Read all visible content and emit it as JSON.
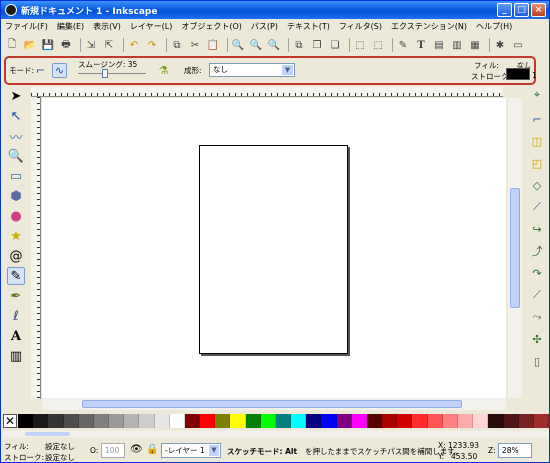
{
  "window": {
    "title": "新規ドキュメント 1 - Inkscape",
    "minimize": "_",
    "maximize": "□",
    "close": "×"
  },
  "menu": [
    "ファイル(F)",
    "編集(E)",
    "表示(V)",
    "レイヤー(L)",
    "オブジェクト(O)",
    "パス(P)",
    "テキスト(T)",
    "フィルタ(S)",
    "エクステンション(N)",
    "ヘルプ(H)"
  ],
  "tool_controls": {
    "mode_label": "モード:",
    "smoothing_label": "スムージング: 35",
    "smoothing_value": 35,
    "shape_label": "成形:",
    "shape_value": "なし",
    "fill_label": "フィル:",
    "fill_value": "なし",
    "stroke_label": "ストローク:",
    "stroke_width": "1"
  },
  "status": {
    "fill_label": "フィル:",
    "fill_value": "設定なし",
    "stroke_label": "ストローク:",
    "stroke_value": "設定なし",
    "opacity_label": "O:",
    "opacity_value": "100",
    "layer_value": "-レイヤー 1",
    "message_bold": "スケッチモード: Alt",
    "message": " を押したままでスケッチパス間を補間します。",
    "x_label": "X:",
    "x_value": "1233.93",
    "y_label": "Y:",
    "y_value": "453.50",
    "zoom_label": "Z:",
    "zoom_value": "28%"
  },
  "palette": [
    "#000000",
    "#1a1a1a",
    "#333333",
    "#4d4d4d",
    "#666666",
    "#808080",
    "#999999",
    "#b3b3b3",
    "#cccccc",
    "#e6e6e6",
    "#ffffff",
    "#800000",
    "#ff0000",
    "#808000",
    "#ffff00",
    "#008000",
    "#00ff00",
    "#008080",
    "#00ffff",
    "#000080",
    "#0000ff",
    "#800080",
    "#ff00ff",
    "#550000",
    "#aa0000",
    "#d40000",
    "#ff2a2a",
    "#ff5555",
    "#ff8080",
    "#ffaaaa",
    "#ffd5d5",
    "#280b0b",
    "#501616",
    "#782121",
    "#a02c2c"
  ],
  "colors": {
    "highlight": "#c0392b",
    "titlebar": "#0a5de0"
  }
}
